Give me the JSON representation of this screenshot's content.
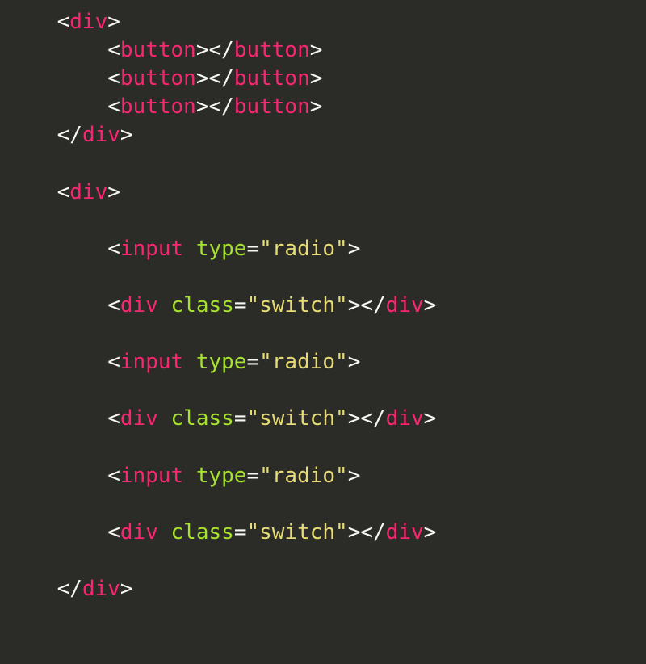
{
  "code": {
    "lines": [
      {
        "indent": 0,
        "tokens": [
          {
            "t": "p",
            "v": "<"
          },
          {
            "t": "tg",
            "v": "div"
          },
          {
            "t": "p",
            "v": ">"
          }
        ]
      },
      {
        "indent": 1,
        "tokens": [
          {
            "t": "p",
            "v": "<"
          },
          {
            "t": "tg",
            "v": "button"
          },
          {
            "t": "p",
            "v": ">"
          },
          {
            "t": "p",
            "v": "</"
          },
          {
            "t": "tg",
            "v": "button"
          },
          {
            "t": "p",
            "v": ">"
          }
        ]
      },
      {
        "indent": 1,
        "tokens": [
          {
            "t": "p",
            "v": "<"
          },
          {
            "t": "tg",
            "v": "button"
          },
          {
            "t": "p",
            "v": ">"
          },
          {
            "t": "p",
            "v": "</"
          },
          {
            "t": "tg",
            "v": "button"
          },
          {
            "t": "p",
            "v": ">"
          }
        ]
      },
      {
        "indent": 1,
        "tokens": [
          {
            "t": "p",
            "v": "<"
          },
          {
            "t": "tg",
            "v": "button"
          },
          {
            "t": "p",
            "v": ">"
          },
          {
            "t": "p",
            "v": "</"
          },
          {
            "t": "tg",
            "v": "button"
          },
          {
            "t": "p",
            "v": ">"
          }
        ]
      },
      {
        "indent": 0,
        "tokens": [
          {
            "t": "p",
            "v": "</"
          },
          {
            "t": "tg",
            "v": "div"
          },
          {
            "t": "p",
            "v": ">"
          }
        ]
      },
      {
        "indent": 0,
        "tokens": []
      },
      {
        "indent": 0,
        "tokens": [
          {
            "t": "p",
            "v": "<"
          },
          {
            "t": "tg",
            "v": "div"
          },
          {
            "t": "p",
            "v": ">"
          }
        ]
      },
      {
        "indent": 0,
        "tokens": []
      },
      {
        "indent": 1,
        "tokens": [
          {
            "t": "p",
            "v": "<"
          },
          {
            "t": "tg",
            "v": "input"
          },
          {
            "t": "p",
            "v": " "
          },
          {
            "t": "at",
            "v": "type"
          },
          {
            "t": "eq",
            "v": "="
          },
          {
            "t": "st",
            "v": "\"radio\""
          },
          {
            "t": "p",
            "v": ">"
          }
        ]
      },
      {
        "indent": 0,
        "tokens": []
      },
      {
        "indent": 1,
        "tokens": [
          {
            "t": "p",
            "v": "<"
          },
          {
            "t": "tg",
            "v": "div"
          },
          {
            "t": "p",
            "v": " "
          },
          {
            "t": "at",
            "v": "class"
          },
          {
            "t": "eq",
            "v": "="
          },
          {
            "t": "st",
            "v": "\"switch\""
          },
          {
            "t": "p",
            "v": ">"
          },
          {
            "t": "p",
            "v": "</"
          },
          {
            "t": "tg",
            "v": "div"
          },
          {
            "t": "p",
            "v": ">"
          }
        ]
      },
      {
        "indent": 0,
        "tokens": []
      },
      {
        "indent": 1,
        "tokens": [
          {
            "t": "p",
            "v": "<"
          },
          {
            "t": "tg",
            "v": "input"
          },
          {
            "t": "p",
            "v": " "
          },
          {
            "t": "at",
            "v": "type"
          },
          {
            "t": "eq",
            "v": "="
          },
          {
            "t": "st",
            "v": "\"radio\""
          },
          {
            "t": "p",
            "v": ">"
          }
        ]
      },
      {
        "indent": 0,
        "tokens": []
      },
      {
        "indent": 1,
        "tokens": [
          {
            "t": "p",
            "v": "<"
          },
          {
            "t": "tg",
            "v": "div"
          },
          {
            "t": "p",
            "v": " "
          },
          {
            "t": "at",
            "v": "class"
          },
          {
            "t": "eq",
            "v": "="
          },
          {
            "t": "st",
            "v": "\"switch\""
          },
          {
            "t": "p",
            "v": ">"
          },
          {
            "t": "p",
            "v": "</"
          },
          {
            "t": "tg",
            "v": "div"
          },
          {
            "t": "p",
            "v": ">"
          }
        ]
      },
      {
        "indent": 0,
        "tokens": []
      },
      {
        "indent": 1,
        "tokens": [
          {
            "t": "p",
            "v": "<"
          },
          {
            "t": "tg",
            "v": "input"
          },
          {
            "t": "p",
            "v": " "
          },
          {
            "t": "at",
            "v": "type"
          },
          {
            "t": "eq",
            "v": "="
          },
          {
            "t": "st",
            "v": "\"radio\""
          },
          {
            "t": "p",
            "v": ">"
          }
        ]
      },
      {
        "indent": 0,
        "tokens": []
      },
      {
        "indent": 1,
        "tokens": [
          {
            "t": "p",
            "v": "<"
          },
          {
            "t": "tg",
            "v": "div"
          },
          {
            "t": "p",
            "v": " "
          },
          {
            "t": "at",
            "v": "class"
          },
          {
            "t": "eq",
            "v": "="
          },
          {
            "t": "st",
            "v": "\"switch\""
          },
          {
            "t": "p",
            "v": ">"
          },
          {
            "t": "p",
            "v": "</"
          },
          {
            "t": "tg",
            "v": "div"
          },
          {
            "t": "p",
            "v": ">"
          }
        ]
      },
      {
        "indent": 0,
        "tokens": []
      },
      {
        "indent": 0,
        "tokens": [
          {
            "t": "p",
            "v": "</"
          },
          {
            "t": "tg",
            "v": "div"
          },
          {
            "t": "p",
            "v": ">"
          }
        ]
      }
    ],
    "indent_unit": "    "
  }
}
